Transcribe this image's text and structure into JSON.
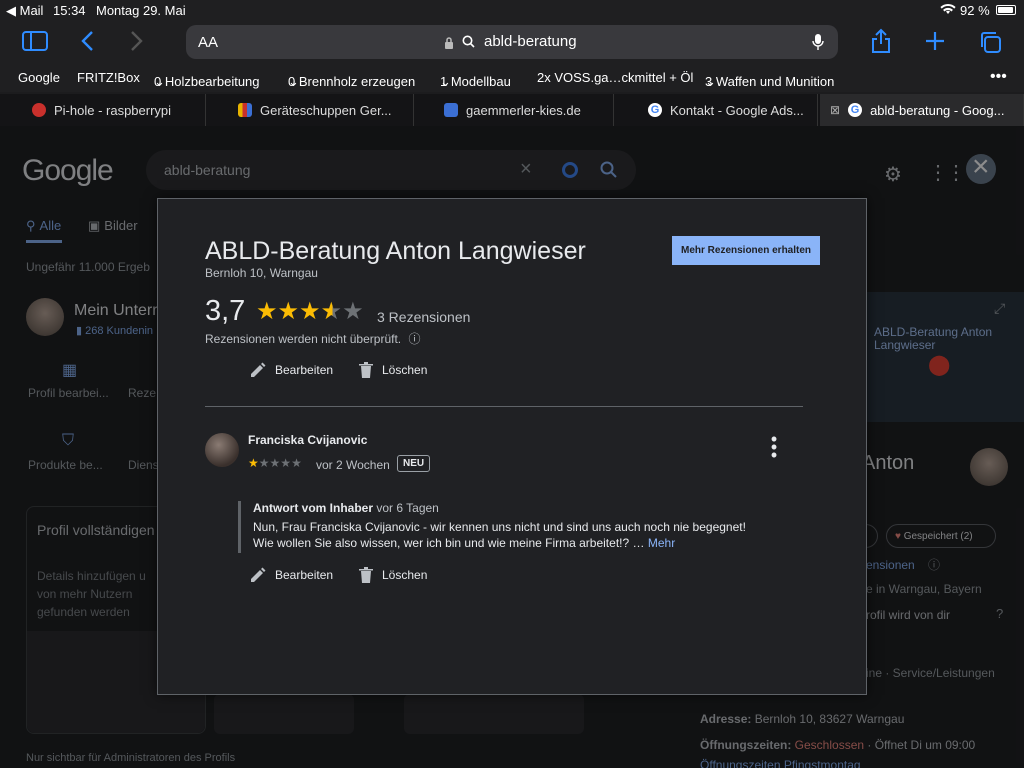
{
  "status": {
    "back_app": "◀ Mail",
    "time": "15:34",
    "date": "Montag 29. Mai",
    "battery": "92 %"
  },
  "browser": {
    "address_aa": "AA",
    "url": "abld-beratung",
    "bookmarks": [
      "Google",
      "FRITZ!Box",
      "0 Holzbearbeitung",
      "0 Brennholz erzeugen",
      "1 Modellbau",
      "2x VOSS.ga…ckmittel + Öl",
      "3 Waffen und Munition"
    ],
    "tabs": [
      {
        "label": "Pi-hole - raspberrypi",
        "color": "#c9302c"
      },
      {
        "label": "Geräteschuppen Ger...",
        "color": "#e8b400"
      },
      {
        "label": "gaemmerler-kies.de",
        "color": "#3b6fd4"
      },
      {
        "label": "Kontakt - Google Ads...",
        "color": "#4285f4"
      },
      {
        "label": "abld-beratung - Goog...",
        "color": "#4285f4"
      }
    ]
  },
  "google": {
    "logo": "Google",
    "query": "abld-beratung",
    "tab_all": "Alle",
    "tab_images": "Bilder",
    "result_count": "Ungefähr 11.000 Ergeb",
    "profile_name": "Mein Unterr",
    "profile_customers": "268 Kundenin",
    "profile_edit": "Profil bearbei...",
    "profile_reviews": "Reze",
    "products": "Produkte be...",
    "services": "Diens",
    "complete_title": "Profil vollständigen",
    "complete_desc": "Details hinzufügen u von mehr Nutzern gefunden werden",
    "admin_note": "Nur sichtbar für Administratoren des Profils",
    "map_label": "ABLD-Beratung Anton Langwieser",
    "kp_name": "Anton",
    "kp_reviews": "ensionen",
    "kp_location": "e in Warngau, Bayern",
    "kp_profile_note": "rofil wird von dir",
    "saved": "Gespeichert (2)",
    "kp_services": "ine · Service/Leistungen",
    "address_label": "Adresse:",
    "address_value": "Bernloh 10, 83627 Warngau",
    "hours_label": "Öffnungszeiten:",
    "hours_status": "Geschlossen",
    "hours_next": "· Öffnet Di um 09:00",
    "hours_holiday": "Öffnungszeiten Pfingstmontag"
  },
  "modal": {
    "title": "ABLD-Beratung Anton Langwieser",
    "address": "Bernloh 10, Warngau",
    "more_reviews_button": "Mehr Rezensionen erhalten",
    "rating": "3,7",
    "rating_value": 3.7,
    "review_count": "3 Rezensionen",
    "not_verified": "Rezensionen werden nicht überprüft.",
    "edit": "Bearbeiten",
    "delete": "Löschen",
    "review": {
      "author": "Franciska Cvijanovic",
      "stars": 1,
      "date": "vor 2 Wochen",
      "badge": "NEU",
      "reply_label": "Antwort vom Inhaber",
      "reply_date": "vor 6 Tagen",
      "reply_line1": "Nun, Frau Franciska Cvijanovic - wir kennen uns nicht und sind uns auch noch nie begegnet!",
      "reply_line2": "Wie wollen Sie also wissen, wer ich bin und wie meine Firma arbeitet!? …",
      "reply_more": "Mehr"
    }
  }
}
